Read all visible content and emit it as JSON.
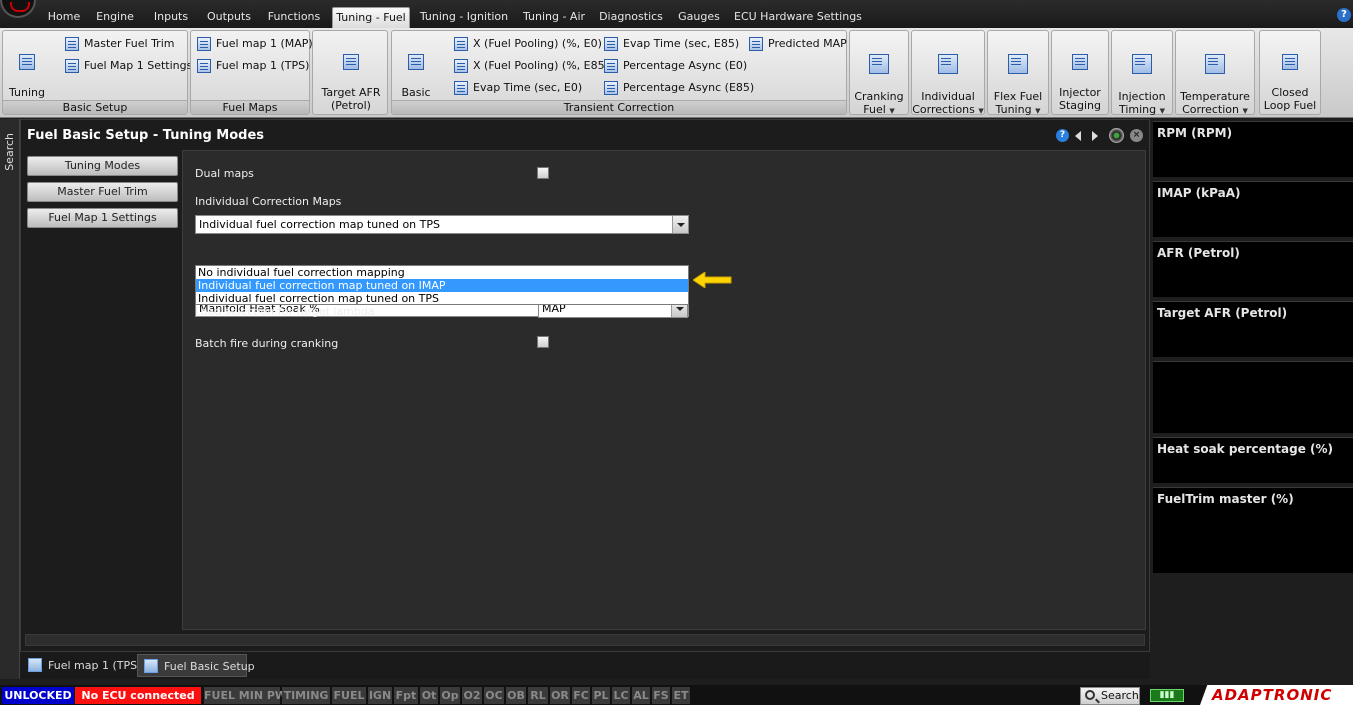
{
  "menu": {
    "tabs": [
      {
        "label": "Home"
      },
      {
        "label": "Engine"
      },
      {
        "label": "Inputs"
      },
      {
        "label": "Outputs"
      },
      {
        "label": "Functions"
      },
      {
        "label": "Tuning - Fuel",
        "active": true
      },
      {
        "label": "Tuning - Ignition"
      },
      {
        "label": "Tuning - Air"
      },
      {
        "label": "Diagnostics"
      },
      {
        "label": "Gauges"
      },
      {
        "label": "ECU Hardware Settings"
      }
    ],
    "help": "?"
  },
  "ribbon": {
    "basic_setup_group": {
      "label": "Basic Setup",
      "tuning_modes": "Tuning\nModes",
      "master_fuel_trim": "Master Fuel Trim",
      "fuel_map_1_settings": "Fuel Map 1 Settings"
    },
    "fuel_maps_group": {
      "label": "Fuel Maps",
      "fuel_map_1_map": "Fuel map 1 (MAP)",
      "fuel_map_1_tps": "Fuel map 1 (TPS)"
    },
    "target_afr": "Target AFR\n(Petrol)",
    "transient_group": {
      "label": "Transient Correction",
      "basic_setup": "Basic\nSetup",
      "x_fuel_pooling_e0": "X (Fuel Pooling) (%, E0)",
      "x_fuel_pooling_e85": "X (Fuel Pooling) (%, E85)",
      "evap_time_e0": "Evap Time (sec, E0)",
      "evap_time_e85_top": "Evap Time (sec, E85)",
      "percentage_async_e0": "Percentage Async (E0)",
      "percentage_async_e85": "Percentage Async (E85)",
      "predicted_map": "Predicted MAP"
    },
    "cranking_fuel": "Cranking\nFuel",
    "individual_corrections": "Individual\nCorrections",
    "flex_fuel_tuning": "Flex Fuel\nTuning",
    "injector_staging": "Injector\nStaging",
    "injection_timing": "Injection\nTiming",
    "temperature_correction": "Temperature\nCorrection",
    "closed_loop_fuel": "Closed\nLoop Fuel"
  },
  "sidebar": {
    "search_label": "Search"
  },
  "window": {
    "title": "Fuel Basic Setup - Tuning Modes",
    "help": "?",
    "close": "×",
    "nav": [
      {
        "label": "Tuning Modes"
      },
      {
        "label": "Master Fuel Trim"
      },
      {
        "label": "Fuel Map 1 Settings"
      }
    ]
  },
  "form": {
    "dual_maps_label": "Dual maps",
    "individual_correction_maps_label": "Individual Correction Maps",
    "individual_correction_value": "Individual fuel correction map tuned on TPS",
    "dropdown_options": [
      {
        "label": "No individual fuel correction mapping"
      },
      {
        "label": "Individual fuel correction map tuned on IMAP",
        "selected": true
      },
      {
        "label": "Individual fuel correction map tuned on TPS"
      }
    ],
    "heat_soak_value": "Manifold Heat Soak %",
    "load_selection_label": "Load selection for target lambda",
    "load_selection_value": "MAP",
    "batch_fire_label": "Batch fire during cranking"
  },
  "doc_tabs": [
    {
      "label": "Fuel map 1 (TPS)"
    },
    {
      "label": "Fuel Basic Setup",
      "active": true
    }
  ],
  "gauges": [
    {
      "label": "RPM (RPM)"
    },
    {
      "label": "IMAP  (kPaA)"
    },
    {
      "label": "AFR (Petrol)"
    },
    {
      "label": "Target AFR (Petrol)"
    },
    {
      "label": ""
    },
    {
      "label": "Heat soak percentage (%)"
    },
    {
      "label": "FuelTrim master (%)"
    }
  ],
  "status": {
    "unlocked": "UNLOCKED",
    "no_ecu": "No ECU connected",
    "indicators": [
      "FUEL MIN PW",
      "TIMING",
      "FUEL",
      "IGN",
      "Fpt",
      "Ot",
      "Op",
      "O2",
      "OC",
      "OB",
      "RL",
      "OR",
      "FC",
      "PL",
      "LC",
      "AL",
      "FS",
      "ET"
    ],
    "search": "Search",
    "brand": "ADAPTRONIC"
  },
  "colors": {
    "accent_yellow": "#ffd400",
    "selection_blue": "#3399ff",
    "unlocked_blue": "#0000cc",
    "no_ecu_red": "#ff1010"
  }
}
